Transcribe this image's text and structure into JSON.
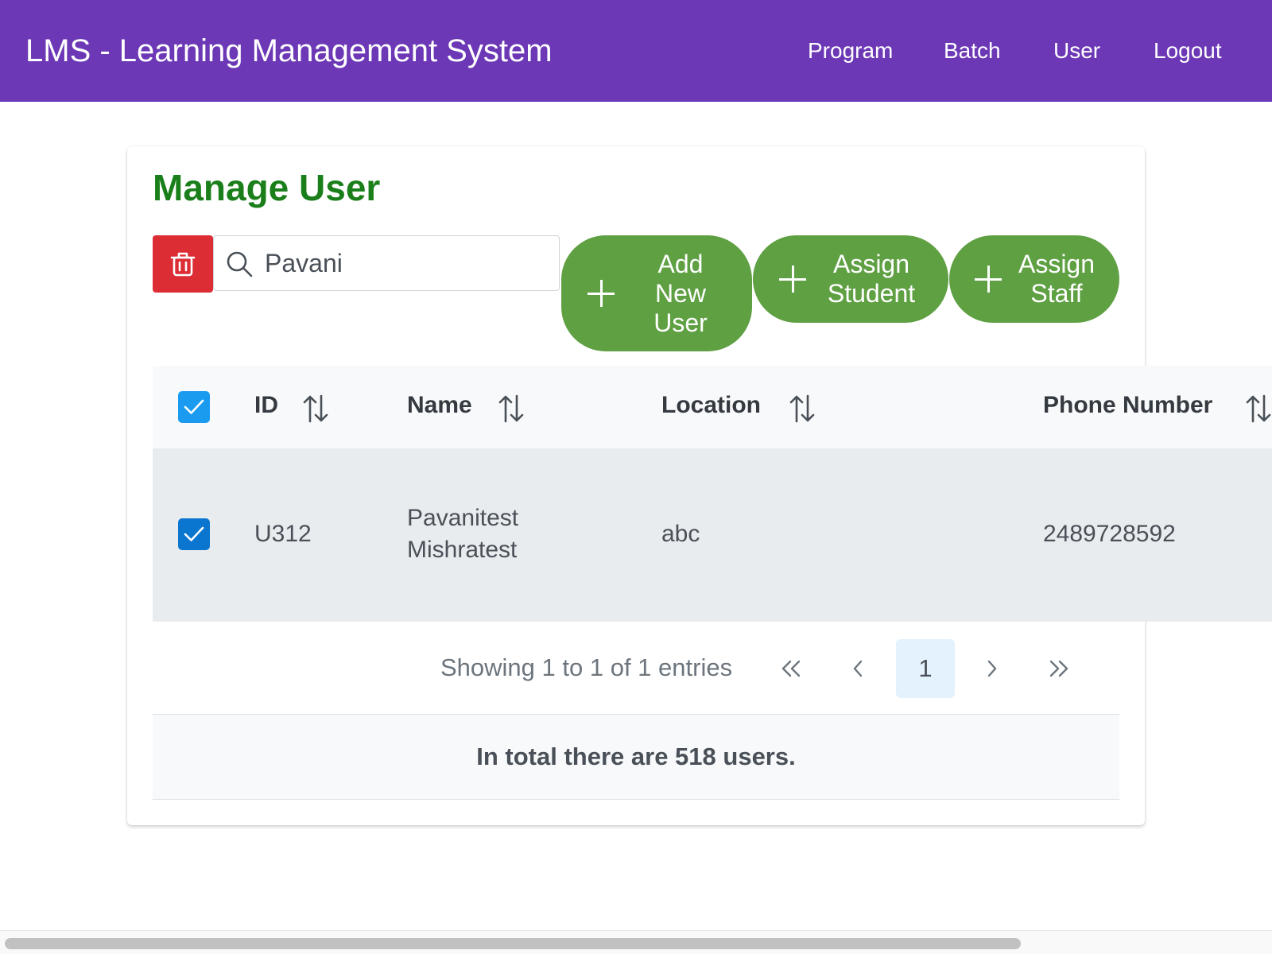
{
  "app": {
    "title": "LMS - Learning Management System"
  },
  "nav": {
    "items": [
      {
        "label": "Program"
      },
      {
        "label": "Batch"
      },
      {
        "label": "User"
      },
      {
        "label": "Logout"
      }
    ]
  },
  "page": {
    "title": "Manage User"
  },
  "toolbar": {
    "search_value": "Pavani",
    "add_user_label": "Add\nNew\nUser",
    "assign_student_label": "Assign\nStudent",
    "assign_staff_label": "Assign\nStaff"
  },
  "table": {
    "header_checked": true,
    "columns": [
      {
        "label": "ID"
      },
      {
        "label": "Name"
      },
      {
        "label": "Location"
      },
      {
        "label": "Phone Number"
      }
    ],
    "rows": [
      {
        "selected": true,
        "id": "U312",
        "name_line1": "Pavanitest",
        "name_line2": "Mishratest",
        "location": "abc",
        "phone": "2489728592"
      }
    ]
  },
  "pagination": {
    "showing_text": "Showing 1 to 1 of 1 entries",
    "current_page": "1",
    "first_icon": "double-chevron-left-icon",
    "prev_icon": "chevron-left-icon",
    "next_icon": "chevron-right-icon",
    "last_icon": "double-chevron-right-icon"
  },
  "summary": {
    "text": "In total there are 518 users."
  },
  "colors": {
    "topbar": "#6c38b5",
    "title_green": "#1a7f1a",
    "button_green": "#5fa043",
    "delete_red": "#dc2c34",
    "checkbox_header": "#1b9bf0",
    "checkbox_row": "#0a76d0",
    "active_page_bg": "#e3f2fd"
  },
  "icons": {
    "delete": "trash-icon",
    "search": "search-icon",
    "add": "plus-icon",
    "sort": "sort-icon",
    "check": "check-icon"
  }
}
